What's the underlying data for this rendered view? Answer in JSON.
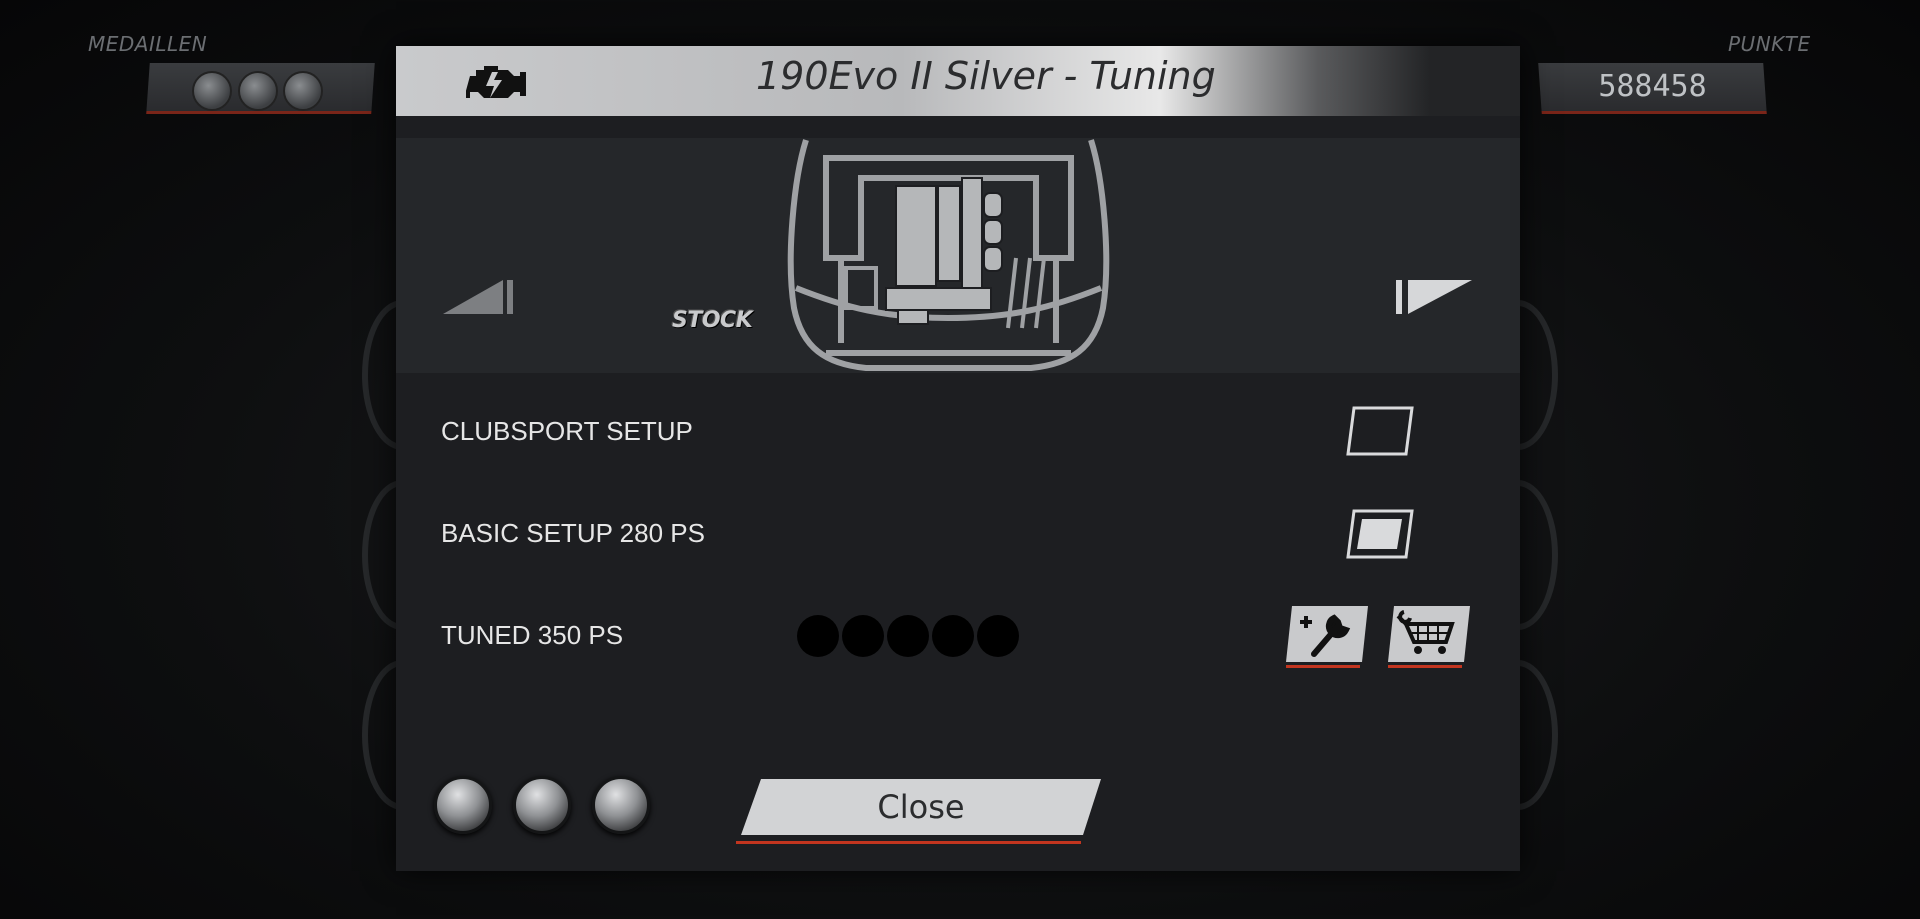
{
  "hud": {
    "medals_label": "MEDAILLEN",
    "points_label": "PUNKTE",
    "points_value": "588458"
  },
  "dialog": {
    "title": "190Evo II Silver - Tuning",
    "stock_badge": "STOCK",
    "options": [
      {
        "label": "CLUBSPORT SETUP",
        "checked": false
      },
      {
        "label": "BASIC SETUP 280 PS",
        "checked": true
      },
      {
        "label": "TUNED 350 PS",
        "progress_dots_filled": 0,
        "progress_dots_total": 5
      }
    ],
    "close_label": "Close",
    "wrench_tokens": 3
  },
  "colors": {
    "accent_red": "#c2351f",
    "panel": "#1d1e21",
    "title_bar": "#c9cacc"
  }
}
